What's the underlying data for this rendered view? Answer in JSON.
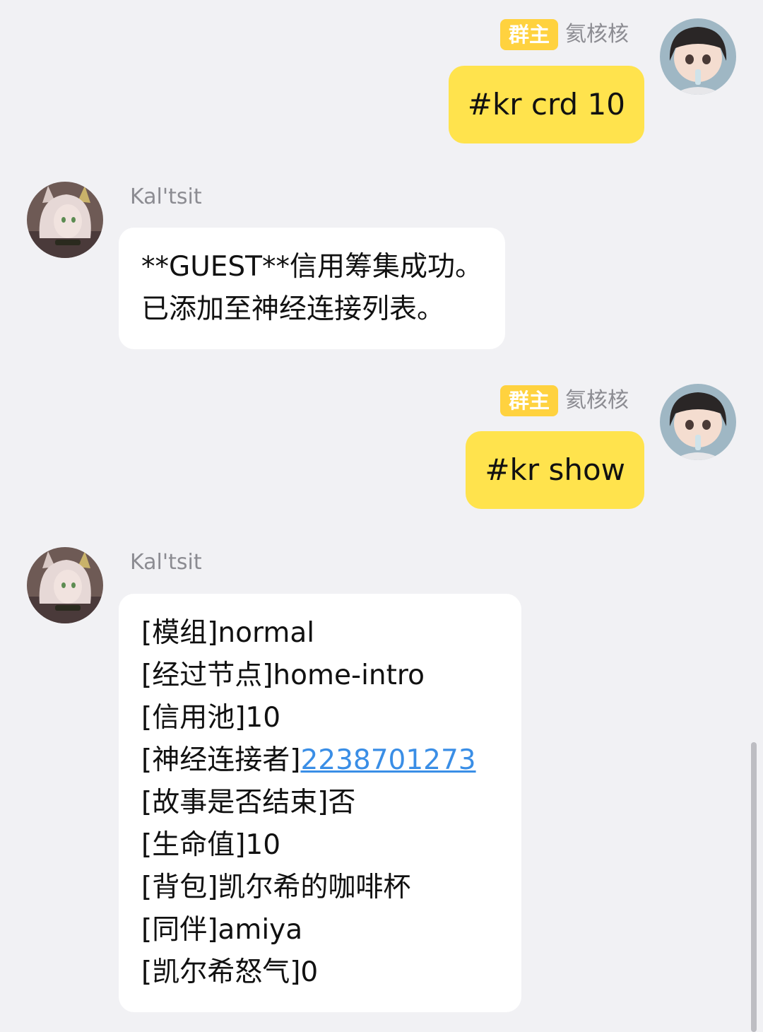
{
  "messages": [
    {
      "direction": "out",
      "badge": "群主",
      "sender": "氦核核",
      "avatar_icon": "user-avatar-icon",
      "text": "#kr crd 10"
    },
    {
      "direction": "in",
      "sender": "Kal'tsit",
      "avatar_icon": "bot-avatar-icon",
      "lines": [
        "**GUEST**信用筹集成功。",
        "已添加至神经连接列表。"
      ]
    },
    {
      "direction": "out",
      "badge": "群主",
      "sender": "氦核核",
      "avatar_icon": "user-avatar-icon",
      "text": "#kr show"
    },
    {
      "direction": "in",
      "sender": "Kal'tsit",
      "avatar_icon": "bot-avatar-icon",
      "lines": [
        "[模组]normal",
        "[经过节点]home-intro",
        "[信用池]10"
      ],
      "link_line": {
        "prefix": "[神经连接者]",
        "link": "2238701273"
      },
      "lines_after": [
        "[故事是否结束]否",
        "[生命值]10",
        "[背包]凯尔希的咖啡杯",
        "[同伴]amiya",
        "[凯尔希怒气]0"
      ]
    }
  ],
  "colors": {
    "background": "#f1f1f4",
    "outgoing_bubble": "#ffe34d",
    "incoming_bubble": "#ffffff",
    "badge": "#ffd23f",
    "link": "#3a8ee6",
    "sender_name": "#8c8c92"
  }
}
